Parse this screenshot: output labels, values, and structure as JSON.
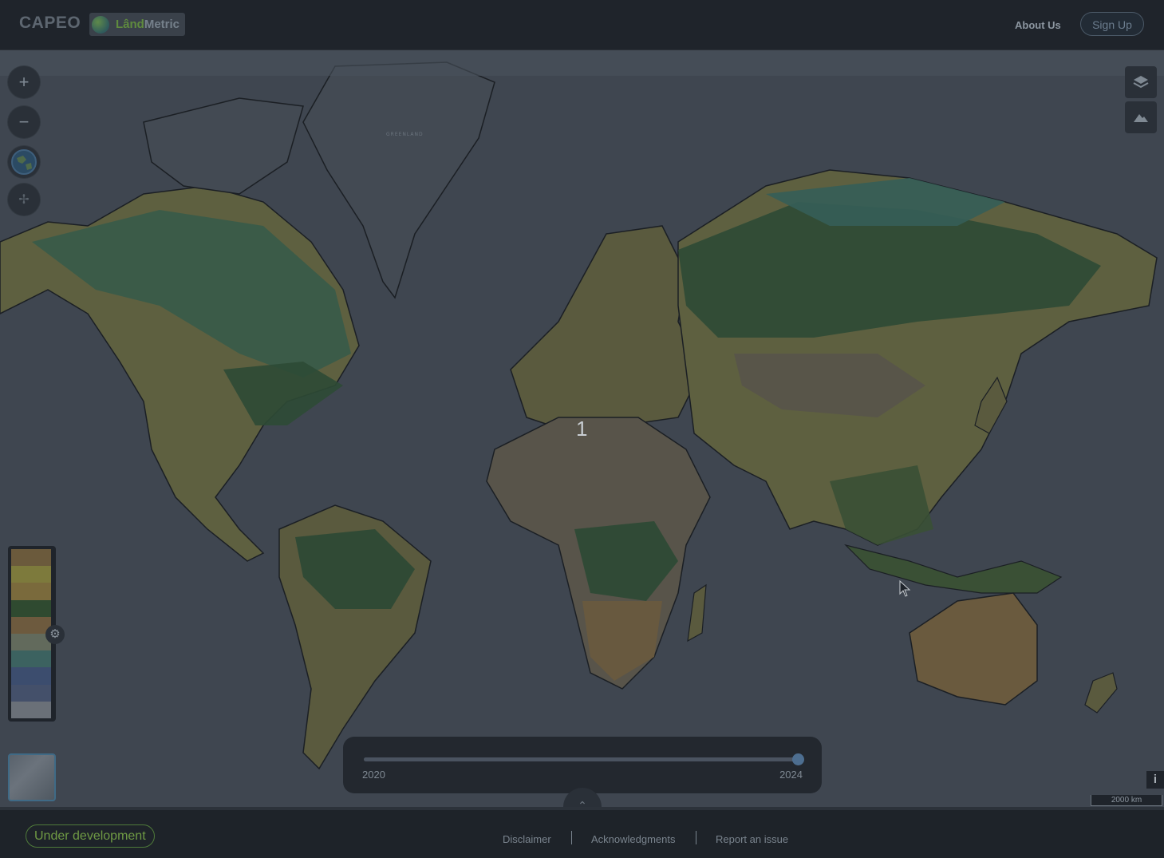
{
  "header": {
    "brand": "CAPEO",
    "logo_text_prefix": "Lând",
    "logo_text_suffix": "Metric",
    "nav_about": "About Us",
    "nav_signup": "Sign Up"
  },
  "map": {
    "label_greenland": "GREENLAND",
    "center_count": "1"
  },
  "controls": {
    "zoom_in": "+",
    "zoom_out": "−",
    "pan": "✢"
  },
  "legend": {
    "swatches": [
      "#6b5a3c",
      "#7d7a3c",
      "#7a6a3c",
      "#2f4a30",
      "#6d5a3e",
      "#626a5c",
      "#3c6260",
      "#3c4d6e",
      "#44506a",
      "#6a7078"
    ]
  },
  "timeline": {
    "start_label": "2020",
    "end_label": "2024",
    "start_year": 2020,
    "end_year": 2024,
    "current_year": 2024
  },
  "info": {
    "label": "i"
  },
  "scale": {
    "label": "2000 km"
  },
  "footer": {
    "badge": "Under development",
    "links": [
      "Disclaimer",
      "Acknowledgments",
      "Report an issue"
    ],
    "separator": "|"
  },
  "colors": {
    "forest": "#2e4a35",
    "savanna": "#6a5a3e",
    "grass": "#6d6a3e",
    "taiga": "#355e58",
    "desert": "#58544a",
    "ocean": "#3f4650",
    "border": "#1b1f24"
  }
}
